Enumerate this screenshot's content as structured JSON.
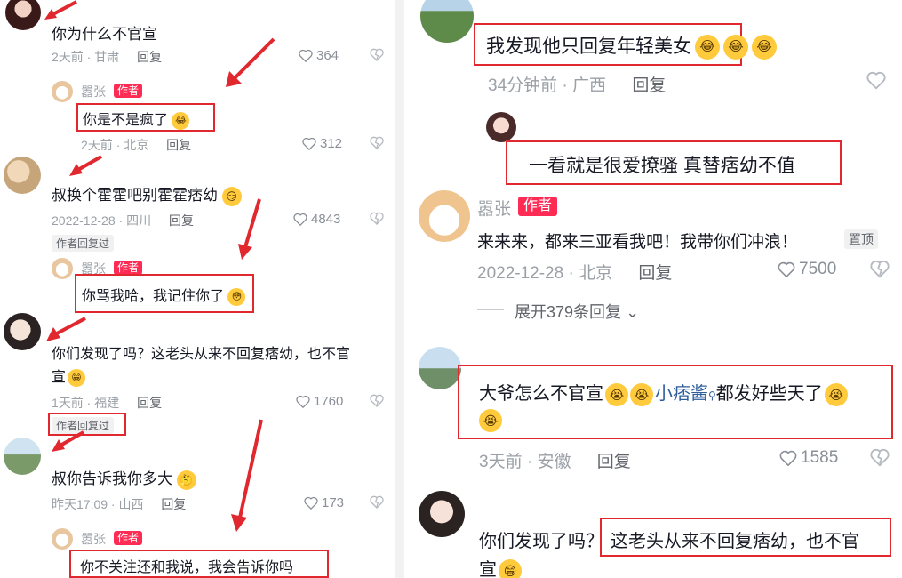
{
  "left": {
    "c1": {
      "text": "你为什么不官宣",
      "time": "2天前",
      "loc": "甘肃",
      "reply": "回复",
      "likes": "364"
    },
    "r1": {
      "user": "嚣张",
      "author_tag": "作者",
      "text": "你是不是疯了",
      "time": "2天前",
      "loc": "北京",
      "reply": "回复",
      "likes": "312"
    },
    "c2": {
      "text": "叔换个霍霍吧别霍霍痞幼",
      "time": "2022-12-28",
      "loc": "四川",
      "reply": "回复",
      "likes": "4843",
      "author_replied": "作者回复过"
    },
    "r2": {
      "user": "嚣张",
      "author_tag": "作者",
      "text": "你骂我哈，我记住你了"
    },
    "c3": {
      "text_line1": "你们发现了吗？这老头从来不回复痞幼，也不官",
      "text_line2": "宣",
      "time": "1天前",
      "loc": "福建",
      "reply": "回复",
      "likes": "1760",
      "author_replied": "作者回复过"
    },
    "c4": {
      "text": "叔你告诉我你多大",
      "time": "昨天17:09",
      "loc": "山西",
      "reply": "回复",
      "likes": "173"
    },
    "r4": {
      "user": "嚣张",
      "author_tag": "作者",
      "text": "你不关注还和我说，我会告诉你吗"
    }
  },
  "right": {
    "c1": {
      "text": "我发现他只回复年轻美女",
      "time": "34分钟前",
      "loc": "广西",
      "reply": "回复"
    },
    "c2": {
      "text": "一看就是很爱撩骚 真替痞幼不值"
    },
    "c3": {
      "user": "嚣张",
      "author_tag": "作者",
      "text": "来来来，都来三亚看我吧！我带你们冲浪！",
      "pinned": "置顶",
      "time": "2022-12-28",
      "loc": "北京",
      "reply": "回复",
      "likes": "7500",
      "expand": "展开379条回复"
    },
    "c4": {
      "text_a": "大爷怎么不官宣",
      "mention": "小痞酱",
      "text_b": "都发好些天了",
      "time": "3天前",
      "loc": "安徽",
      "reply": "回复",
      "likes": "1585"
    },
    "c5": {
      "text_a": "你们发现了吗",
      "text_b": "这老头从来不回复痞幼，也不官",
      "text_line2": "宣"
    }
  },
  "colors": {
    "author_tag": "#fe2c55",
    "highlight_box": "#e0282e",
    "meta": "#9aa0a6",
    "mention": "#2f5d9c"
  },
  "separator": "·"
}
